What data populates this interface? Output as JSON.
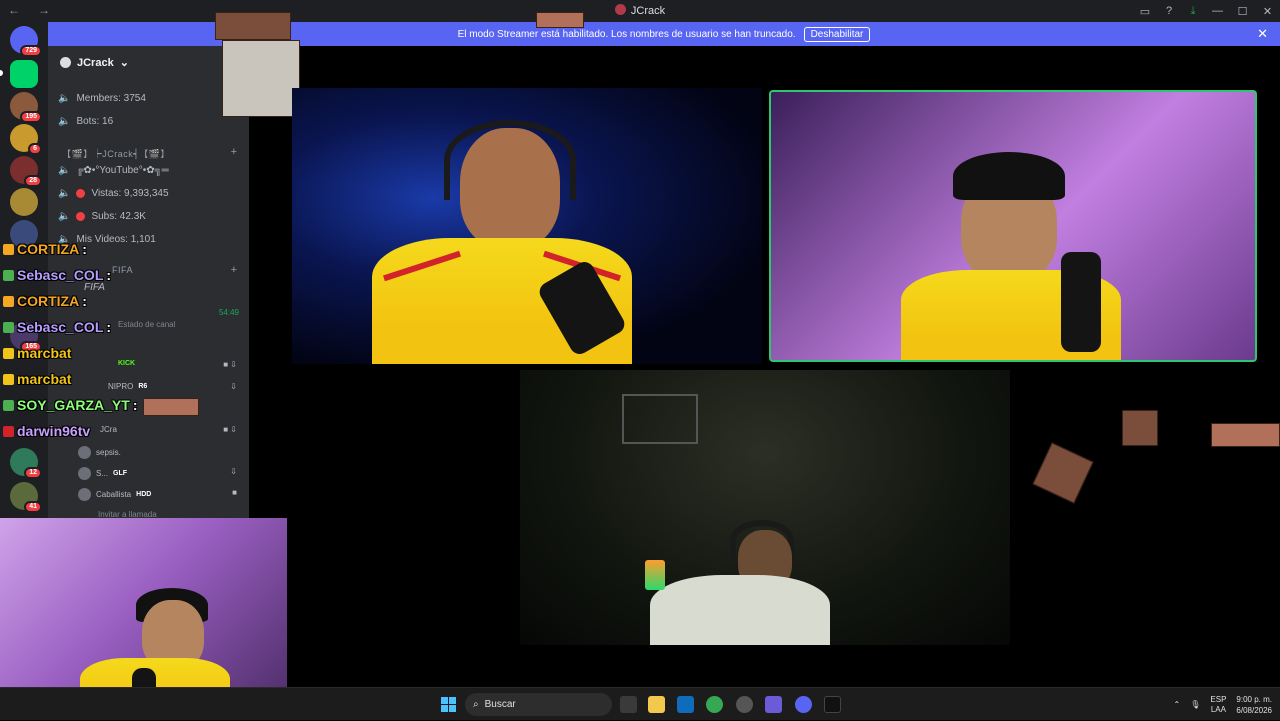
{
  "titlebar": {
    "title": "JCrack",
    "back": "←",
    "forward": "→"
  },
  "banner": {
    "message": "El modo Streamer está habilitado. Los nombres de usuario se han truncado.",
    "button": "Deshabilitar"
  },
  "rail": {
    "badges": [
      "729",
      "195",
      "6",
      "28",
      "165",
      "12",
      "41"
    ]
  },
  "sidebar": {
    "server_name": "JCrack",
    "channels": [
      {
        "label": "Members: 3754"
      },
      {
        "label": "Bots: 16"
      }
    ],
    "category": "【🎬】┝JCrack┥【🎬】",
    "stats": [
      {
        "label": "╔✿•°YouTube°•✿╗═"
      },
      {
        "label": "Vistas: 9,393,345"
      },
      {
        "label": "Subs: 42.3K"
      },
      {
        "label": "Mis Videos: 1,101"
      }
    ],
    "category2": "FIFA",
    "voice_channel": "FIFA",
    "timer": "54:49",
    "voice_status": "Estado de canal",
    "voice_users": [
      {
        "name": "KICK"
      },
      {
        "name": "NIPRO",
        "tag": "R6"
      },
      {
        "name": "JCra"
      },
      {
        "name": "sepsis."
      },
      {
        "name": "S...",
        "tag": "GLF"
      },
      {
        "name": "Caballista",
        "tag": "HDD"
      }
    ],
    "invite": "Invitar a llamada"
  },
  "chat": [
    {
      "user": "CORTIZA",
      "color": "#f5a623"
    },
    {
      "user": "Sebasc_COL",
      "color": "#b79cff"
    },
    {
      "user": "CORTIZA",
      "color": "#f5a623"
    },
    {
      "user": "Sebasc_COL",
      "color": "#b79cff"
    },
    {
      "user": "marcbat",
      "color": "#f0c419"
    },
    {
      "user": "marcbat",
      "color": "#f0c419"
    },
    {
      "user": "SOY_GARZA_YT",
      "color": "#8cff7a"
    },
    {
      "user": "darwin96tv",
      "color": "#c9a0ff"
    }
  ],
  "taskbar": {
    "search": "Buscar",
    "lang_top": "ESP",
    "lang_bottom": "LAA",
    "time": "9:00 p. m.",
    "date": "6/08/2026"
  }
}
